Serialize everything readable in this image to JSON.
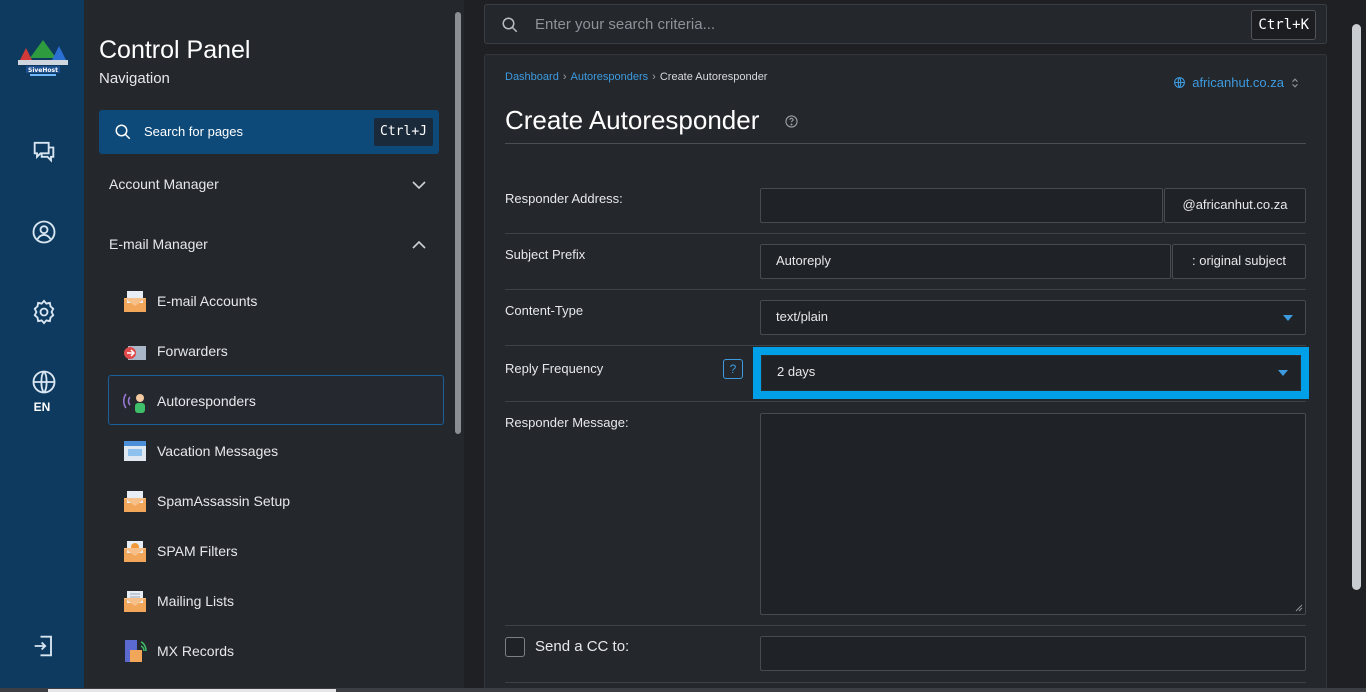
{
  "rail": {
    "language": "EN",
    "icons": [
      "chat-icon",
      "user-icon",
      "settings-icon",
      "globe-icon",
      "logout-icon"
    ]
  },
  "nav": {
    "title": "Control Panel",
    "subtitle": "Navigation",
    "search_label": "Search for pages",
    "search_shortcut": "Ctrl+J",
    "sections": [
      {
        "label": "Account Manager",
        "expanded": false
      },
      {
        "label": "E-mail Manager",
        "expanded": true
      }
    ],
    "items": [
      {
        "label": "E-mail Accounts",
        "icon": "email-accounts-icon",
        "active": false
      },
      {
        "label": "Forwarders",
        "icon": "forwarders-icon",
        "active": false
      },
      {
        "label": "Autoresponders",
        "icon": "autoresponders-icon",
        "active": true
      },
      {
        "label": "Vacation Messages",
        "icon": "vacation-messages-icon",
        "active": false
      },
      {
        "label": "SpamAssassin Setup",
        "icon": "spamassassin-icon",
        "active": false
      },
      {
        "label": "SPAM Filters",
        "icon": "spam-filters-icon",
        "active": false
      },
      {
        "label": "Mailing Lists",
        "icon": "mailing-lists-icon",
        "active": false
      },
      {
        "label": "MX Records",
        "icon": "mx-records-icon",
        "active": false
      }
    ]
  },
  "top_search": {
    "placeholder": "Enter your search criteria...",
    "shortcut": "Ctrl+K"
  },
  "breadcrumb": {
    "items": [
      "Dashboard",
      "Autoresponders"
    ],
    "current": "Create Autoresponder"
  },
  "domain": "africanhut.co.za",
  "page_title": "Create Autoresponder",
  "form": {
    "responder_address": {
      "label": "Responder Address:",
      "value": "",
      "suffix": "@africanhut.co.za"
    },
    "subject_prefix": {
      "label": "Subject Prefix",
      "value": "Autoreply",
      "suffix": ": original subject"
    },
    "content_type": {
      "label": "Content-Type",
      "value": "text/plain"
    },
    "reply_frequency": {
      "label": "Reply Frequency",
      "value": "2 days",
      "help": "?"
    },
    "responder_message": {
      "label": "Responder Message:",
      "value": ""
    },
    "send_cc": {
      "label": "Send a CC to:",
      "checked": false,
      "value": ""
    }
  },
  "colors": {
    "rail": "#0d3a5e",
    "accent": "#3d9be0",
    "highlight": "#00a0e8"
  }
}
